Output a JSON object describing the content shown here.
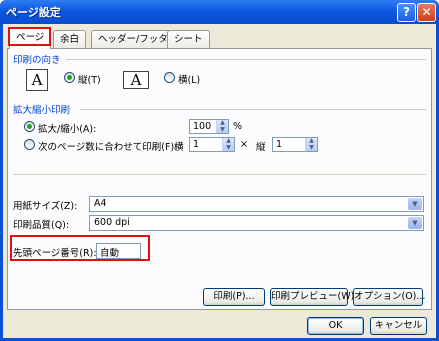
{
  "window": {
    "title": "ページ設定",
    "help_glyph": "?",
    "close_glyph": "✕"
  },
  "tabs": [
    {
      "label": "ページ",
      "active": true
    },
    {
      "label": "余白",
      "active": false
    },
    {
      "label": "ヘッダー/フッター",
      "active": false
    },
    {
      "label": "シート",
      "active": false
    }
  ],
  "orientation": {
    "group_label": "印刷の向き",
    "icon_glyph": "A",
    "portrait_label": "縦(T)",
    "landscape_label": "横(L)",
    "selected": "portrait"
  },
  "scaling": {
    "group_label": "拡大縮小印刷",
    "zoom_label": "拡大/縮小(A):",
    "zoom_value": "100",
    "zoom_unit": "%",
    "fit_label": "次のページ数に合わせて印刷(F):",
    "wide_label": "横",
    "wide_value": "1",
    "times": "×",
    "tall_label": "縦",
    "tall_value": "1",
    "selected": "zoom"
  },
  "paper": {
    "label": "用紙サイズ(Z):",
    "value": "A4"
  },
  "quality": {
    "label": "印刷品質(Q):",
    "value": "600 dpi"
  },
  "first_page": {
    "label": "先頭ページ番号(R):",
    "value": "自動"
  },
  "buttons": {
    "print": "印刷(P)...",
    "preview": "印刷プレビュー(W)",
    "options": "オプション(O)...",
    "ok": "OK",
    "cancel": "キャンセル"
  },
  "arrows": {
    "up": "▲",
    "down": "▼"
  },
  "colors": {
    "accent_blue": "#0046d5",
    "highlight_red": "#dd1111",
    "titlebar": "#0a4fd6"
  }
}
